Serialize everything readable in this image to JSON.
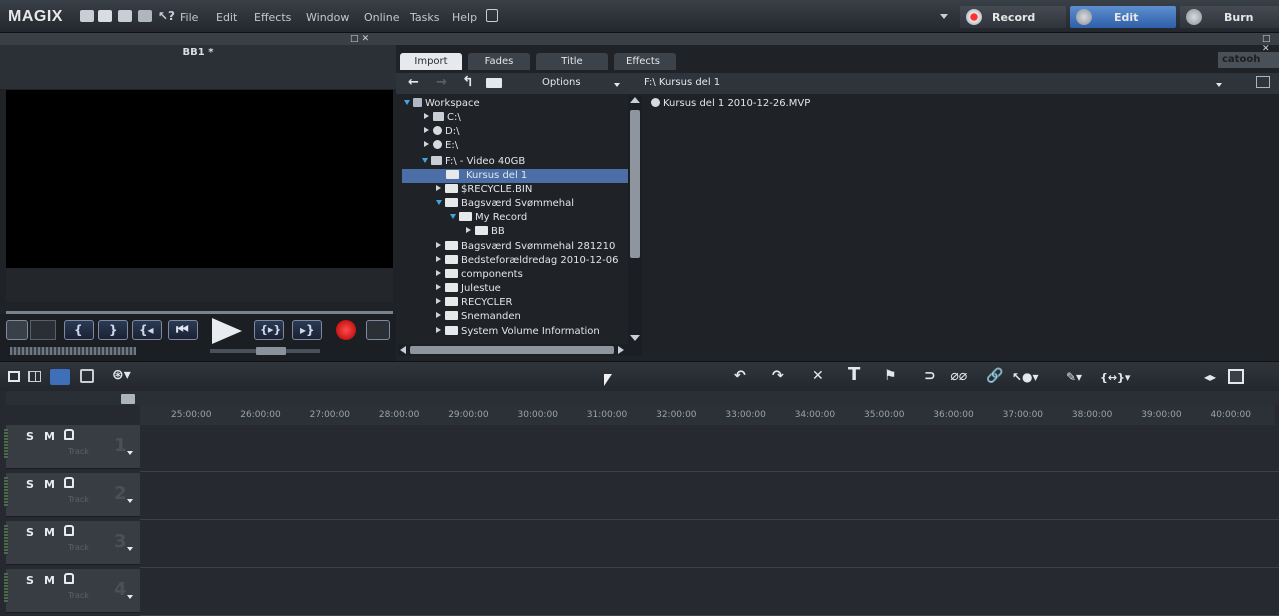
{
  "app": {
    "name": "MAGIX"
  },
  "menu": [
    "File",
    "Edit",
    "Effects",
    "Window",
    "Online",
    "Tasks",
    "Help"
  ],
  "modes": {
    "record": "Record",
    "edit": "Edit",
    "burn": "Burn"
  },
  "preview": {
    "title": "BB1 *"
  },
  "browser": {
    "tabs": [
      "Import",
      "Fades",
      "Title",
      "Effects"
    ],
    "active_tab": "Import",
    "options_label": "Options",
    "path": "F:\\ Kursus del 1",
    "brand": "catooh",
    "tree": [
      {
        "label": "Workspace",
        "type": "workspace",
        "expanded": true,
        "level": 0
      },
      {
        "label": "C:\\",
        "type": "drive",
        "level": 1
      },
      {
        "label": "D:\\",
        "type": "disc",
        "level": 1
      },
      {
        "label": "E:\\",
        "type": "disc",
        "level": 1
      },
      {
        "label": "F:\\ - Video 40GB",
        "type": "drive",
        "expanded": true,
        "level": 1
      },
      {
        "label": "Kursus del 1",
        "type": "folder",
        "level": 2,
        "selected": true
      },
      {
        "label": "$RECYCLE.BIN",
        "type": "folder",
        "level": 2
      },
      {
        "label": "Bagsværd Svømmehal",
        "type": "folder",
        "expanded": true,
        "level": 2
      },
      {
        "label": "My Record",
        "type": "folder",
        "expanded": true,
        "level": 3
      },
      {
        "label": "BB",
        "type": "folder",
        "level": 4
      },
      {
        "label": "Bagsværd Svømmehal 281210",
        "type": "folder",
        "level": 2
      },
      {
        "label": "Bedsteforældredag 2010-12-06",
        "type": "folder",
        "level": 2
      },
      {
        "label": "components",
        "type": "folder",
        "level": 2
      },
      {
        "label": "Julestue",
        "type": "folder",
        "level": 2
      },
      {
        "label": "RECYCLER",
        "type": "folder",
        "level": 2
      },
      {
        "label": "Snemanden",
        "type": "folder",
        "level": 2
      },
      {
        "label": "System Volume Information",
        "type": "folder",
        "level": 2
      }
    ],
    "files": [
      "Kursus del 1 2010-12-26.MVP"
    ]
  },
  "timeline": {
    "ruler": [
      "25:00:00",
      "26:00:00",
      "27:00:00",
      "28:00:00",
      "29:00:00",
      "30:00:00",
      "31:00:00",
      "32:00:00",
      "33:00:00",
      "34:00:00",
      "35:00:00",
      "36:00:00",
      "37:00:00",
      "38:00:00",
      "39:00:00",
      "40:00:00"
    ],
    "tracks": [
      {
        "number": "1",
        "label": "Track"
      },
      {
        "number": "2",
        "label": "Track"
      },
      {
        "number": "3",
        "label": "Track"
      },
      {
        "number": "4",
        "label": "Track"
      }
    ],
    "track_buttons": {
      "solo": "S",
      "mute": "M"
    }
  }
}
